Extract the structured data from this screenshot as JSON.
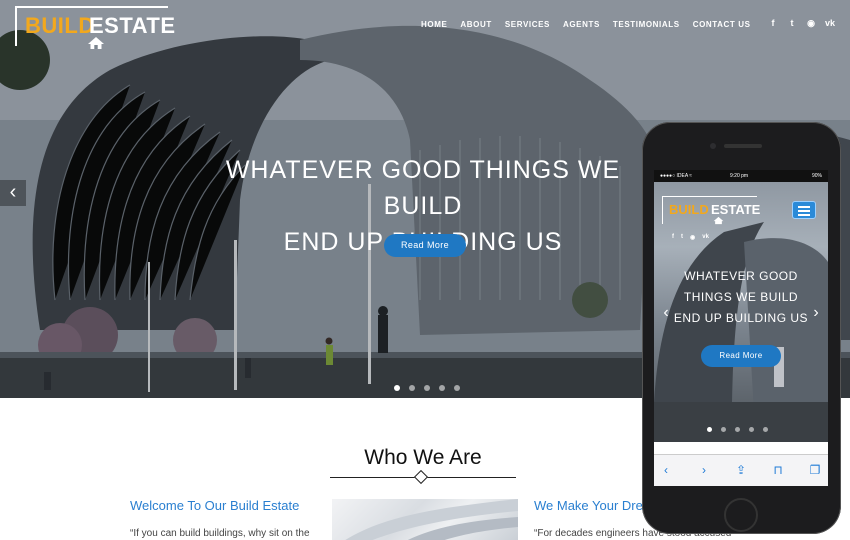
{
  "brand": {
    "part1": "BUILD",
    "part2": "ESTATE"
  },
  "nav": {
    "items": [
      "HOME",
      "ABOUT",
      "SERVICES",
      "AGENTS",
      "TESTIMONIALS",
      "CONTACT US"
    ]
  },
  "social": {
    "icons": [
      "facebook-icon",
      "twitter-icon",
      "rss-icon",
      "vk-icon"
    ],
    "glyphs": [
      "f",
      "t",
      "◉",
      "vk"
    ]
  },
  "hero": {
    "headline_line1": "WHATEVER GOOD THINGS WE BUILD",
    "headline_line2": "END UP BUILDING US",
    "button_label": "Read More",
    "slides": 5,
    "active_slide": 1
  },
  "who": {
    "title": "Who We Are",
    "left_title": "Welcome To Our Build Estate",
    "left_text": "“If you can build buildings, why sit on the",
    "right_title": "We Make Your Dre",
    "right_text": "“For decades engineers have stood accused"
  },
  "phone": {
    "status": {
      "carrier": "●●●●○ IDEA ≈",
      "time": "9:20 pm",
      "battery": "90%"
    },
    "headline_l1": "WHATEVER GOOD",
    "headline_l2": "THINGS WE BUILD",
    "headline_l3": "END UP BUILDING US",
    "button_label": "Read More",
    "toolbar_icons": [
      "back-icon",
      "forward-icon",
      "share-icon",
      "bookmarks-icon",
      "tabs-icon"
    ],
    "toolbar_glyphs": [
      "‹",
      "›",
      "⇪",
      "⊓",
      "❐"
    ]
  },
  "colors": {
    "accent": "#f2a81d",
    "primary": "#1f78c3",
    "link": "#2a7fd0"
  }
}
